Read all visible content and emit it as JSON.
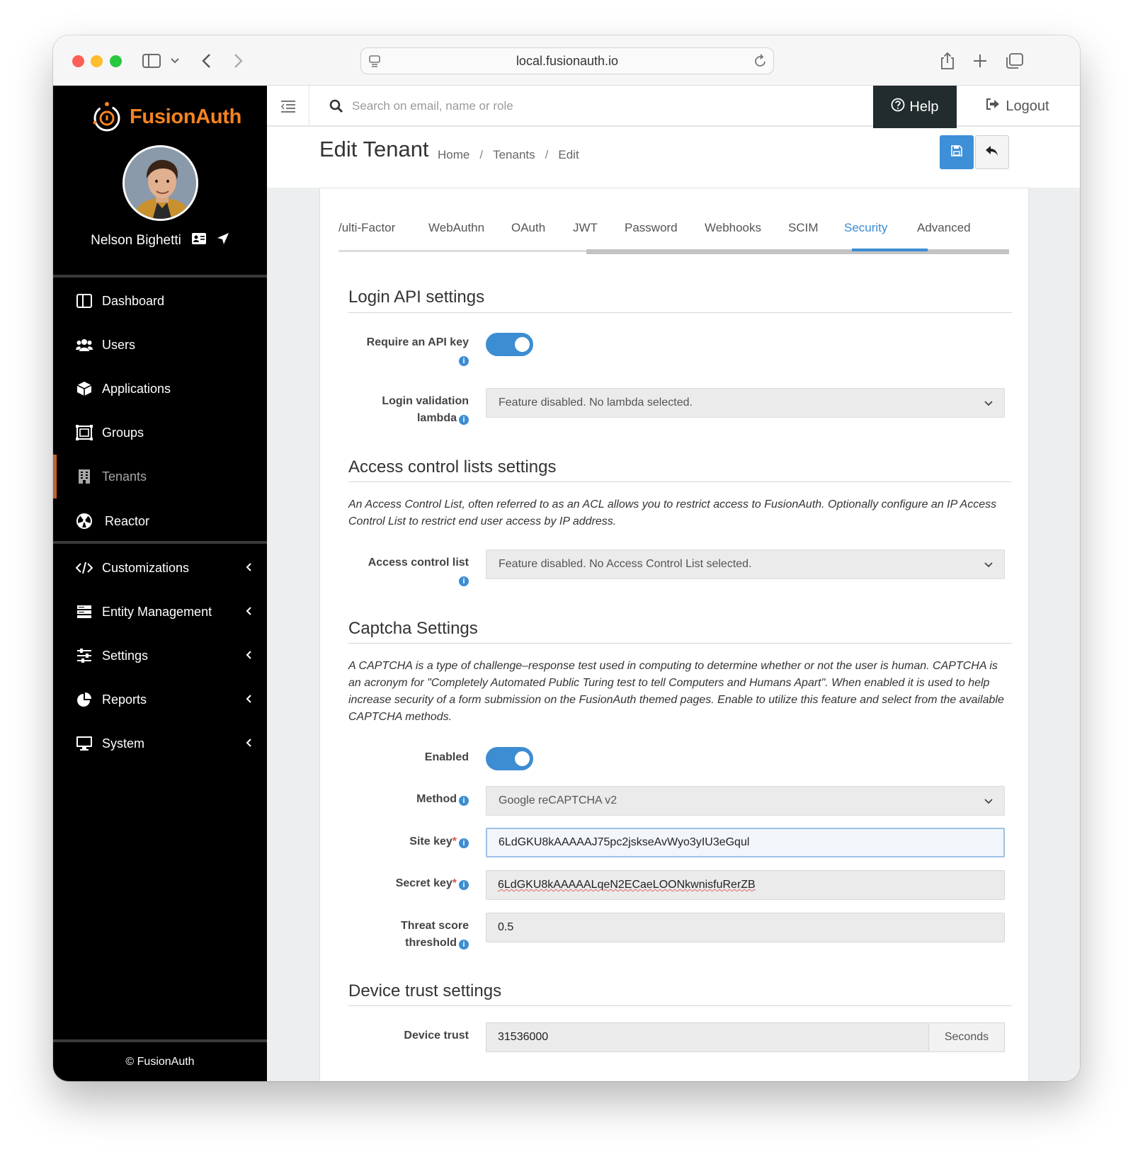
{
  "browser": {
    "url": "local.fusionauth.io"
  },
  "brand": {
    "name": "FusionAuth",
    "accent": "#f58320"
  },
  "user": {
    "name": "Nelson Bighetti"
  },
  "sidebar": {
    "items": [
      {
        "label": "Dashboard",
        "icon": "dashboard-icon"
      },
      {
        "label": "Users",
        "icon": "users-icon"
      },
      {
        "label": "Applications",
        "icon": "cube-icon"
      },
      {
        "label": "Groups",
        "icon": "groups-icon"
      },
      {
        "label": "Tenants",
        "icon": "building-icon",
        "active": true
      },
      {
        "label": "Reactor",
        "icon": "reactor-icon"
      },
      {
        "label": "Customizations",
        "icon": "code-icon",
        "expandable": true
      },
      {
        "label": "Entity Management",
        "icon": "server-icon",
        "expandable": true
      },
      {
        "label": "Settings",
        "icon": "sliders-icon",
        "expandable": true
      },
      {
        "label": "Reports",
        "icon": "pie-chart-icon",
        "expandable": true
      },
      {
        "label": "System",
        "icon": "desktop-icon",
        "expandable": true
      }
    ],
    "footer": "© FusionAuth"
  },
  "topbar": {
    "search_placeholder": "Search on email, name or role",
    "help_label": "Help",
    "logout_label": "Logout"
  },
  "page": {
    "title": "Edit Tenant",
    "breadcrumb": [
      "Home",
      "Tenants",
      "Edit"
    ]
  },
  "tabs": [
    {
      "label": "\u0010ulti-Factor"
    },
    {
      "label": "WebAuthn"
    },
    {
      "label": "OAuth"
    },
    {
      "label": "JWT"
    },
    {
      "label": "Password"
    },
    {
      "label": "Webhooks"
    },
    {
      "label": "SCIM"
    },
    {
      "label": "Security",
      "active": true
    },
    {
      "label": "Advanced"
    }
  ],
  "login_api": {
    "title": "Login API settings",
    "require_api_key_label": "Require an API key",
    "require_api_key": true,
    "login_validation_label_1": "Login validation",
    "login_validation_label_2": "lambda",
    "login_validation_value": "Feature disabled. No lambda selected."
  },
  "acl": {
    "title": "Access control lists settings",
    "description": "An Access Control List, often referred to as an ACL allows you to restrict access to FusionAuth. Optionally configure an IP Access Control List to restrict end user access by IP address.",
    "label": "Access control list",
    "value": "Feature disabled. No Access Control List selected."
  },
  "captcha": {
    "title": "Captcha Settings",
    "description": "A CAPTCHA is a type of challenge–response test used in computing to determine whether or not the user is human. CAPTCHA is an acronym for \"Completely Automated Public Turing test to tell Computers and Humans Apart\". When enabled it is used to help increase security of a form submission on the FusionAuth themed pages. Enable to utilize this feature and select from the available CAPTCHA methods.",
    "enabled_label": "Enabled",
    "enabled": true,
    "method_label": "Method",
    "method_value": "Google reCAPTCHA v2",
    "site_key_label": "Site key",
    "site_key_value": "6LdGKU8kAAAAAJ75pc2jskseAvWyo3yIU3eGqul",
    "secret_key_label": "Secret key",
    "secret_key_value": "6LdGKU8kAAAAALqeN2ECaeLOONkwnisfuRerZB",
    "threshold_label_1": "Threat score",
    "threshold_label_2": "threshold",
    "threshold_value": "0.5"
  },
  "device_trust": {
    "title": "Device trust settings",
    "label": "Device trust",
    "value": "31536000",
    "unit": "Seconds"
  },
  "colors": {
    "primary": "#3c8dd2",
    "sidebar_bg": "#000000",
    "help_bg": "#222b2d"
  }
}
